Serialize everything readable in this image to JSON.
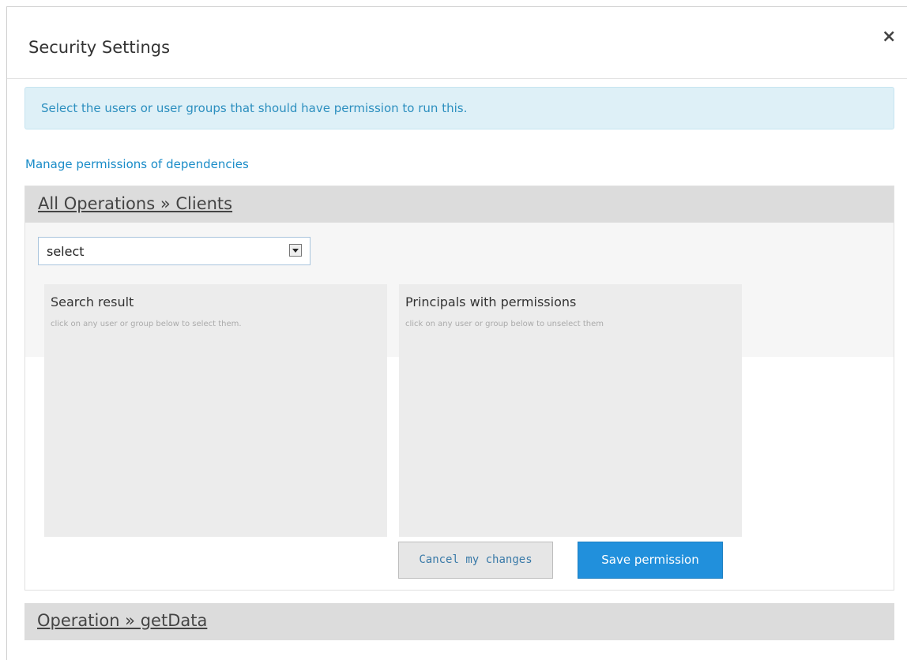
{
  "dialog": {
    "title": "Security Settings",
    "close_icon": "×"
  },
  "info": {
    "text": "Select the users or user groups that should have permission to run this."
  },
  "manage_link": "Manage permissions of dependencies",
  "panel": {
    "heading": "All Operations » Clients",
    "select": {
      "value": "select"
    },
    "search_result": {
      "title": "Search result",
      "hint": "click on any user or group below to select them."
    },
    "principals": {
      "title": "Principals with permissions",
      "hint": "click on any user or group below to unselect them"
    },
    "cancel_label": "Cancel my changes",
    "save_label": "Save permission"
  },
  "panel2": {
    "heading": "Operation » getData"
  },
  "colors": {
    "accent": "#2190dc",
    "info_bg": "#def0f7",
    "info_text": "#2c8fbf",
    "link": "#1a8cc8",
    "panel_head": "#dcdcdc"
  }
}
